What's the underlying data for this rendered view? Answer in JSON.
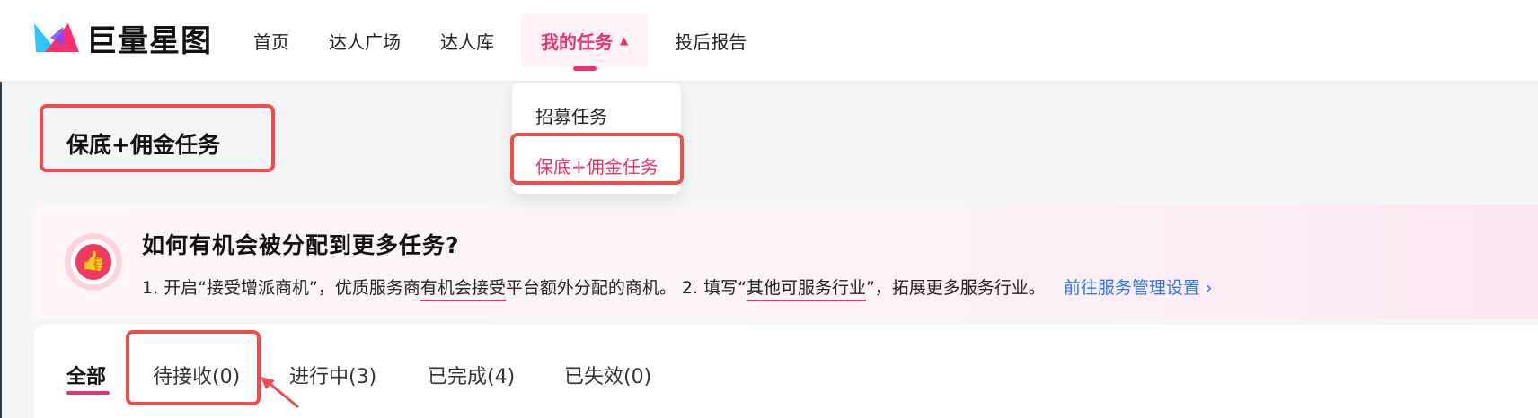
{
  "header": {
    "logo_text": "巨量星图",
    "nav": [
      {
        "label": "首页"
      },
      {
        "label": "达人广场"
      },
      {
        "label": "达人库"
      },
      {
        "label": "我的任务",
        "caret": "▲"
      },
      {
        "label": "投后报告"
      }
    ]
  },
  "dropdown": {
    "items": [
      {
        "label": "招募任务"
      },
      {
        "label": "保底+佣金任务"
      }
    ]
  },
  "page": {
    "title": "保底+佣金任务"
  },
  "info": {
    "title": "如何有机会被分配到更多任务?",
    "text_1": "1. 开启“接受增派商机”，优质服务商",
    "text_1_ul": "有机会接受",
    "text_2": "平台额外分配的商机。 2. 填写“",
    "text_2_ul": "其他可服务行业",
    "text_3": "”，拓展更多服务行业。",
    "link": "前往服务管理设置 ›",
    "icon": "thumbs-up-icon"
  },
  "tabs": [
    {
      "label": "全部"
    },
    {
      "label": "待接收(0)"
    },
    {
      "label": "进行中(3)"
    },
    {
      "label": "已完成(4)"
    },
    {
      "label": "已失效(0)"
    }
  ],
  "colors": {
    "accent": "#e8336b",
    "annotation_red": "#ee4d4d",
    "link_blue": "#2b73ff"
  }
}
